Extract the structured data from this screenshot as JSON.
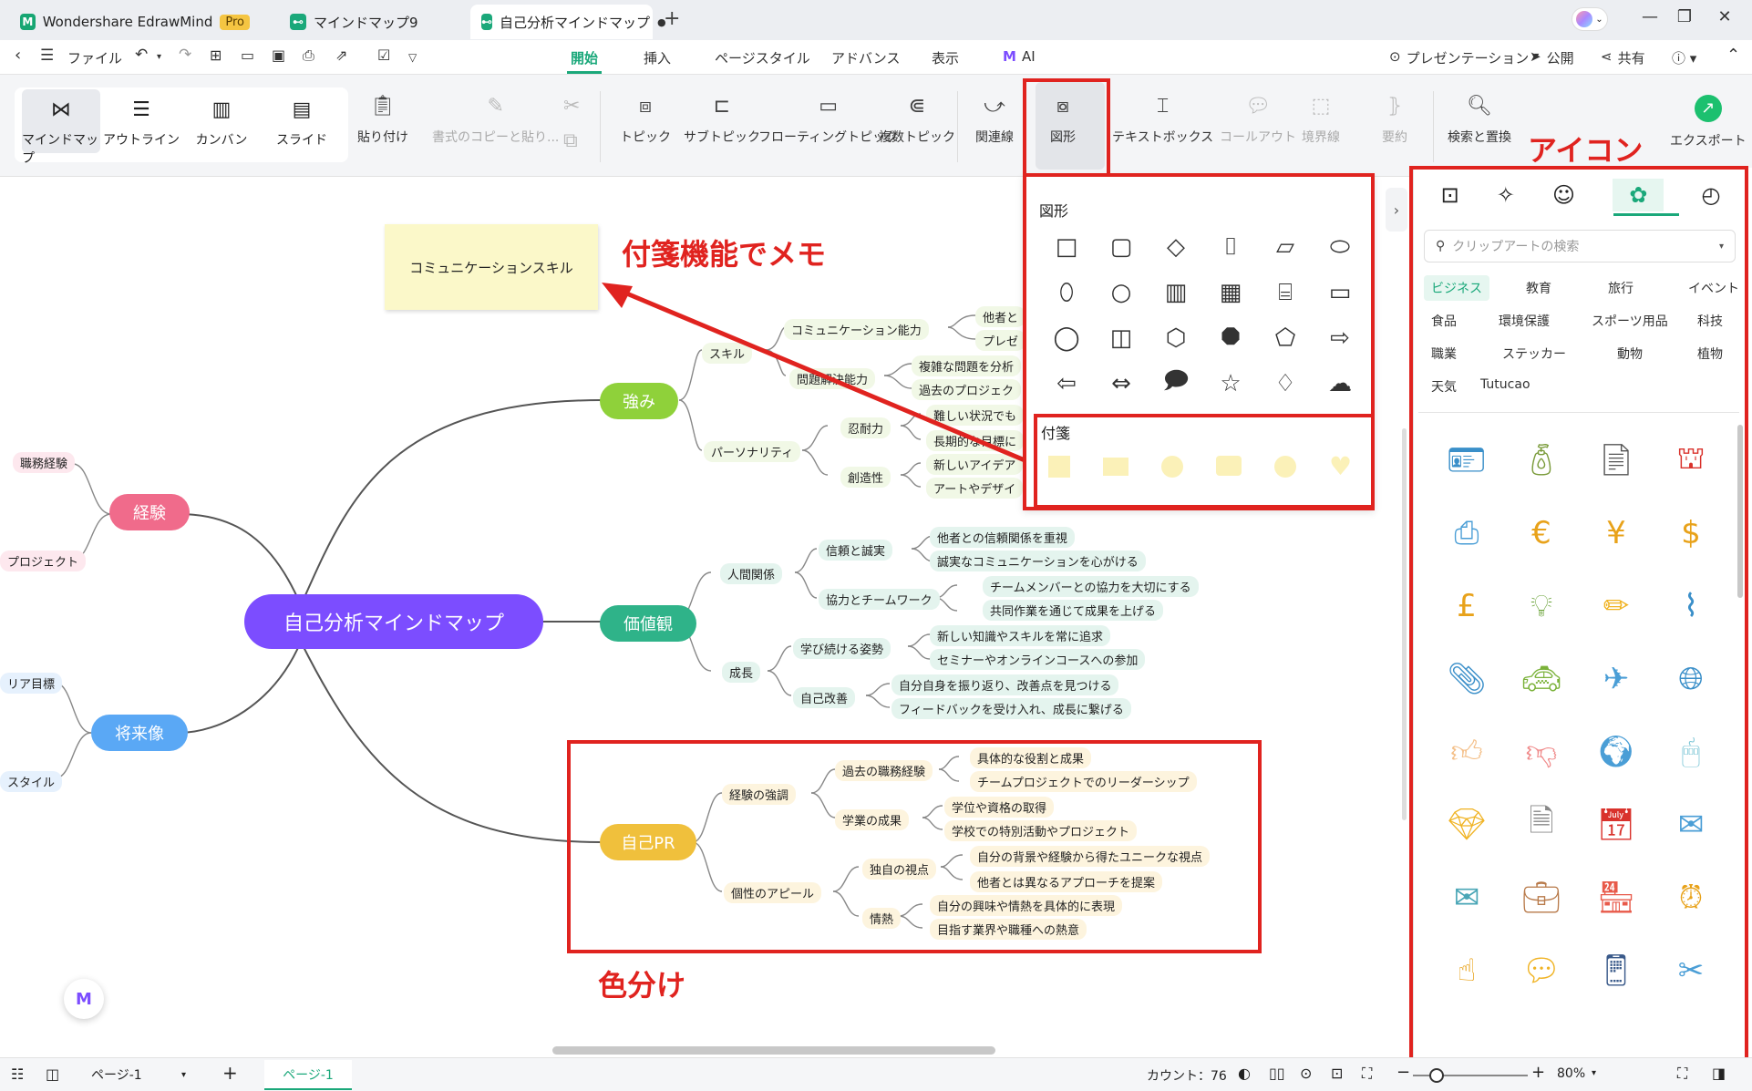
{
  "titlebar": {
    "tabs": [
      {
        "label": "Wondershare EdrawMind",
        "badge": "Pro"
      },
      {
        "label": "マインドマップ9"
      },
      {
        "label": "自己分析マインドマップ",
        "dot": "●"
      }
    ],
    "new_tab": "+"
  },
  "menu": {
    "file": "ファイル",
    "tabs": [
      "開始",
      "挿入",
      "ページスタイル",
      "アドバンス",
      "表示",
      "AI"
    ],
    "present": "プレゼンテーション",
    "publish": "公開",
    "share": "共有"
  },
  "ribbon": {
    "views": [
      "マインドマップ",
      "アウトライン",
      "カンバン",
      "スライド"
    ],
    "paste": "貼り付け",
    "format_copy": "書式のコピーと貼り...",
    "topic": "トピック",
    "subtopic": "サブトピック",
    "floating": "フローティングトピック",
    "multi": "複数トピック",
    "relation": "関連線",
    "shape": "図形",
    "textbox": "テキストボックス",
    "callout": "コールアウト",
    "boundary": "境界線",
    "summary": "要約",
    "find_replace": "検索と置換",
    "export": "エクスポート"
  },
  "shape_panel": {
    "title": "図形",
    "sticky_title": "付箋"
  },
  "icon_panel": {
    "search_placeholder": "クリップアートの検索",
    "categories": [
      "ビジネス",
      "教育",
      "旅行",
      "イベント",
      "食品",
      "環境保護",
      "スポーツ用品",
      "科技",
      "職業",
      "ステッカー",
      "動物",
      "植物",
      "天気",
      "Tutucao"
    ]
  },
  "annotations": {
    "sticky_memo": "付箋機能でメモ",
    "icon": "アイコン",
    "color_coding": "色分け"
  },
  "sticky_note": "コミュニケーションスキル",
  "mindmap": {
    "central": "自己分析マインドマップ",
    "left": {
      "experience": "経験",
      "exp_children": [
        "職務経験",
        "プロジェクト"
      ],
      "future": "将来像",
      "future_children": [
        "リア目標",
        "スタイル"
      ]
    },
    "strength": {
      "label": "強み",
      "skill": "スキル",
      "comm": "コミュニケーション能力",
      "comm_children": [
        "他者と",
        "プレゼ"
      ],
      "problem": "問題解決能力",
      "problem_children": [
        "複雑な問題を分析",
        "過去のプロジェク"
      ],
      "personality": "パーソナリティ",
      "patience": "忍耐力",
      "patience_children": [
        "難しい状況でも",
        "長期的な目標に"
      ],
      "creativity": "創造性",
      "creativity_children": [
        "新しいアイデア",
        "アートやデザイ"
      ]
    },
    "values": {
      "label": "価値観",
      "relations": "人間関係",
      "trust": "信頼と誠実",
      "trust_children": [
        "他者との信頼関係を重視",
        "誠実なコミュニケーションを心がける"
      ],
      "team": "協力とチームワーク",
      "team_children": [
        "チームメンバーとの協力を大切にする",
        "共同作業を通じて成果を上げる"
      ],
      "growth": "成長",
      "learning": "学び続ける姿勢",
      "learning_children": [
        "新しい知識やスキルを常に追求",
        "セミナーやオンラインコースへの参加"
      ],
      "improve": "自己改善",
      "improve_children": [
        "自分自身を振り返り、改善点を見つける",
        "フィードバックを受け入れ、成長に繋げる"
      ]
    },
    "pr": {
      "label": "自己PR",
      "emphasis": "経験の強調",
      "past": "過去の職務経験",
      "past_children": [
        "具体的な役割と成果",
        "チームプロジェクトでのリーダーシップ"
      ],
      "academic": "学業の成果",
      "academic_children": [
        "学位や資格の取得",
        "学校での特別活動やプロジェクト"
      ],
      "appeal": "個性のアピール",
      "unique": "独自の視点",
      "unique_children": [
        "自分の背景や経験から得たユニークな視点",
        "他者とは異なるアプローチを提案"
      ],
      "passion": "情熱",
      "passion_children": [
        "自分の興味や情熱を具体的に表現",
        "目指す業界や職種への熱意"
      ]
    }
  },
  "status": {
    "page_select": "ページ-1",
    "page_tab": "ページ-1",
    "count": "カウント：76",
    "zoom": "80%"
  },
  "colors": {
    "central": "#7c4dff",
    "strength": "#8fd13a",
    "values": "#2fb389",
    "pr": "#f0c03c",
    "experience": "#f06b8b",
    "future": "#5aa8f5",
    "accent": "#1aa87a",
    "annotation": "#e0231f"
  }
}
